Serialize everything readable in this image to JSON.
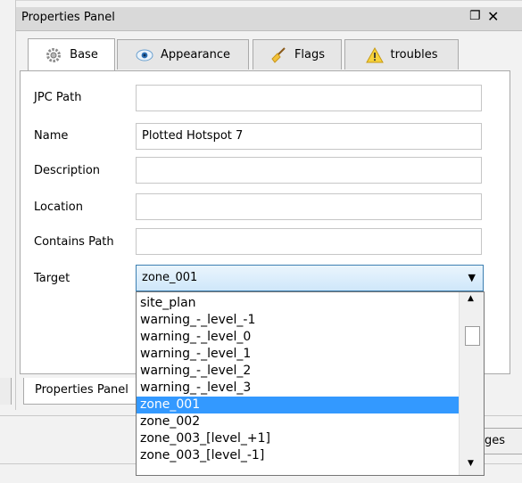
{
  "panel": {
    "title": "Properties Panel",
    "float_glyph": "❐",
    "close_glyph": "✕"
  },
  "tabs": [
    {
      "label": "Base",
      "icon": "gear-icon"
    },
    {
      "label": "Appearance",
      "icon": "eye-icon"
    },
    {
      "label": "Flags",
      "icon": "broom-icon"
    },
    {
      "label": "troubles",
      "icon": "warning-icon"
    }
  ],
  "form": {
    "jpc_path": {
      "label": "JPC Path",
      "value": ""
    },
    "name": {
      "label": "Name",
      "value": "Plotted Hotspot 7"
    },
    "description": {
      "label": "Description",
      "value": ""
    },
    "location": {
      "label": "Location",
      "value": ""
    },
    "contains_path": {
      "label": "Contains Path",
      "value": ""
    },
    "target": {
      "label": "Target",
      "value": "zone_001",
      "arrow": "▼"
    }
  },
  "dropdown": {
    "options": [
      "site_plan",
      "warning_-_level_-1",
      "warning_-_level_0",
      "warning_-_level_1",
      "warning_-_level_2",
      "warning_-_level_3",
      "zone_001",
      "zone_002",
      "zone_003_[level_+1]",
      "zone_003_[level_-1]"
    ],
    "selected_index": 6,
    "scroll_up": "▲",
    "scroll_down": "▼"
  },
  "bottom": {
    "tab_label": "Properties Panel",
    "changes_label": "ges"
  },
  "colors": {
    "selection": "#3399ff",
    "select_border": "#3c7fb1"
  }
}
